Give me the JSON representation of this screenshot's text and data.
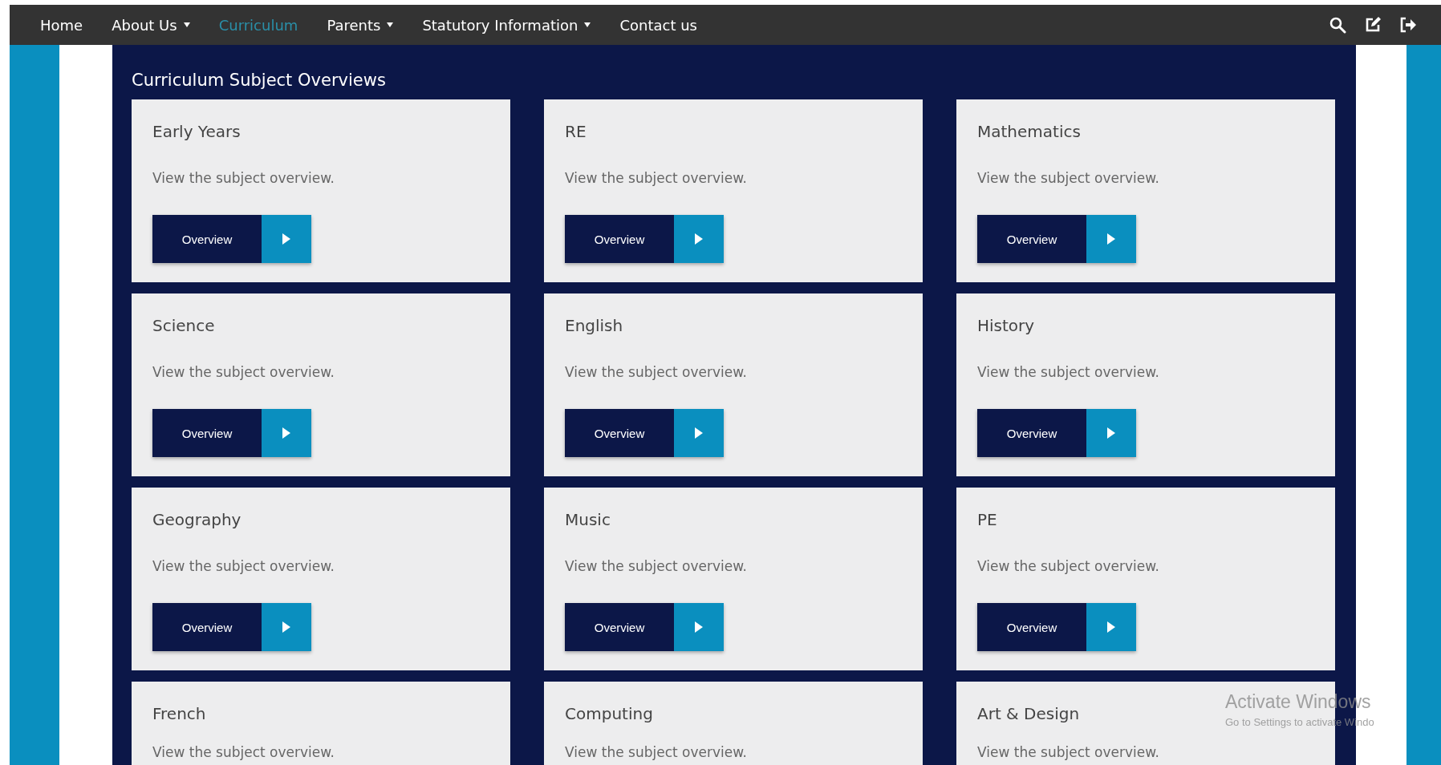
{
  "nav": {
    "items": [
      {
        "label": "Home",
        "has_menu": false,
        "selected": false
      },
      {
        "label": "About Us",
        "has_menu": true,
        "selected": false
      },
      {
        "label": "Curriculum",
        "has_menu": false,
        "selected": true
      },
      {
        "label": "Parents",
        "has_menu": true,
        "selected": false
      },
      {
        "label": "Statutory Information",
        "has_menu": true,
        "selected": false
      },
      {
        "label": "Contact us",
        "has_menu": false,
        "selected": false
      }
    ]
  },
  "panel": {
    "title": "Curriculum Subject Overviews",
    "cards": [
      {
        "title": "Early Years",
        "text": "View the subject overview.",
        "button": "Overview"
      },
      {
        "title": "RE",
        "text": "View the subject overview.",
        "button": "Overview"
      },
      {
        "title": "Mathematics",
        "text": "View the subject overview.",
        "button": "Overview"
      },
      {
        "title": "Science",
        "text": "View the subject overview.",
        "button": "Overview"
      },
      {
        "title": "English",
        "text": "View the subject overview.",
        "button": "Overview"
      },
      {
        "title": "History",
        "text": "View the subject overview.",
        "button": "Overview"
      },
      {
        "title": "Geography",
        "text": "View the subject overview.",
        "button": "Overview"
      },
      {
        "title": "Music",
        "text": "View the subject overview.",
        "button": "Overview"
      },
      {
        "title": "PE",
        "text": "View the subject overview.",
        "button": "Overview"
      },
      {
        "title": "French",
        "text": "View the subject overview."
      },
      {
        "title": "Computing",
        "text": "View the subject overview."
      },
      {
        "title": "Art & Design",
        "text": "View the subject overview."
      }
    ]
  },
  "os_notice": {
    "title": "Activate Windows",
    "hint": "Go to Settings to activate Windo"
  }
}
